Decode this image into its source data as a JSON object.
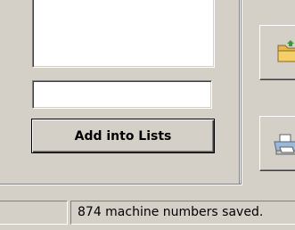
{
  "lists_panel": {
    "add_button_label": "Add into Lists",
    "text_input_value": "",
    "list_items": []
  },
  "side_buttons": {
    "open_icon": "folder-icon",
    "print_icon": "printer-icon"
  },
  "statusbar": {
    "left_pane_text": "",
    "right_pane_text": "874 machine numbers saved."
  },
  "colors": {
    "face": "#d4d0c8",
    "folder_yellow": "#f5d06a"
  }
}
